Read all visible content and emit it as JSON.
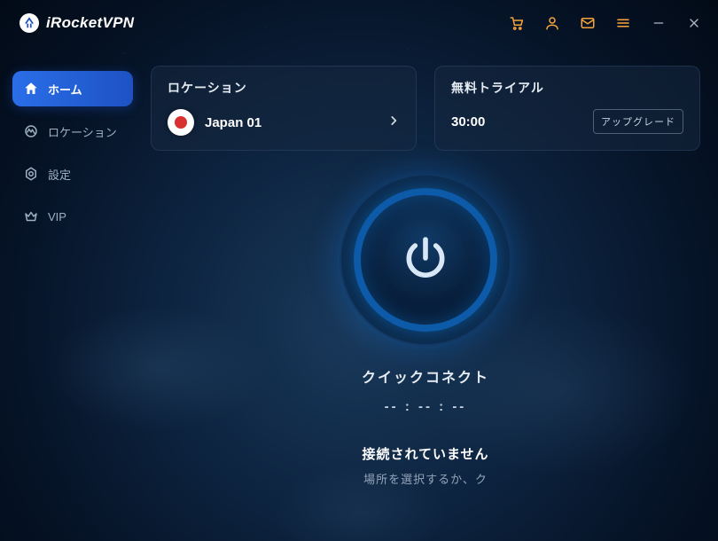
{
  "brand": {
    "name": "iRocketVPN"
  },
  "titlebar_icons": {
    "cart": "cart-icon",
    "user": "user-icon",
    "mail": "mail-icon",
    "menu": "menu-icon",
    "minimize": "minimize-icon",
    "close": "close-icon"
  },
  "sidebar": {
    "items": [
      {
        "id": "home",
        "label": "ホーム",
        "icon": "home-icon",
        "active": true
      },
      {
        "id": "location",
        "label": "ロケーション",
        "icon": "location-icon",
        "active": false
      },
      {
        "id": "settings",
        "label": "設定",
        "icon": "settings-icon",
        "active": false
      },
      {
        "id": "vip",
        "label": "VIP",
        "icon": "vip-icon",
        "active": false
      }
    ]
  },
  "location_card": {
    "title": "ロケーション",
    "flag": "jp",
    "name": "Japan 01"
  },
  "trial_card": {
    "title": "無料トライアル",
    "time": "30:00",
    "upgrade_label": "アップグレード"
  },
  "connect": {
    "quick_label": "クイックコネクト",
    "timer": "-- : -- : --"
  },
  "status": {
    "title": "接続されていません",
    "subtitle": "場所を選択するか、ク"
  }
}
